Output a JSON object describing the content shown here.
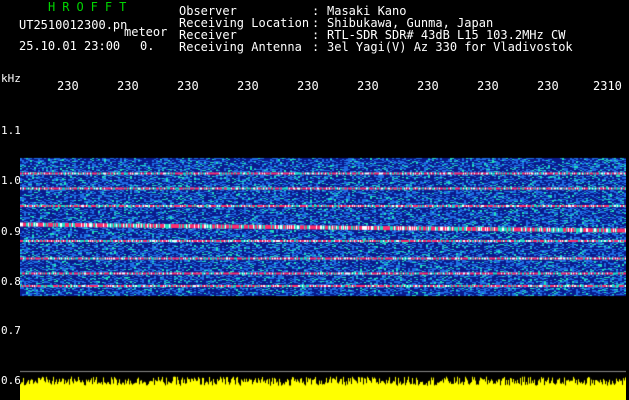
{
  "header": {
    "title": "HROFFT",
    "file_name": "UT2510012300.pn",
    "meteor_label": "meteor",
    "datetime": "25.10.01 23:00",
    "meteor_count": "0.",
    "rows": [
      {
        "label": "Observer",
        "sep": ":",
        "value": "Masaki Kano"
      },
      {
        "label": "Receiving Location",
        "sep": ":",
        "value": "Shibukawa, Gunma, Japan"
      },
      {
        "label": "Receiver",
        "sep": ":",
        "value": "RTL-SDR SDR# 43dB L15 103.2MHz CW"
      },
      {
        "label": "Receiving Antenna",
        "sep": ":",
        "value": "3el Yagi(V) Az 330 for Vladivostok"
      }
    ]
  },
  "axes": {
    "y_unit": "kHz",
    "y_ticks": [
      "1.1",
      "1.0",
      "0.9",
      "0.8",
      "0.7",
      "0.6"
    ],
    "x_ticks": [
      "230",
      "230",
      "230",
      "230",
      "230",
      "230",
      "230",
      "230",
      "230",
      "2310"
    ]
  },
  "colors": {
    "title": "#00d400",
    "background": "#000000",
    "noise_low": "#0a1a8c",
    "noise_mid": "#1e6ee6",
    "noise_high": "#20e0c0",
    "signal": "#ff2d6e",
    "amplitude": "#ffff00"
  },
  "spectrogram": {
    "freq_range_khz": [
      0.77,
      1.045
    ],
    "signal_lines_khz": [
      1.015,
      0.985,
      0.95,
      0.915,
      0.88,
      0.845,
      0.815,
      0.79
    ]
  }
}
